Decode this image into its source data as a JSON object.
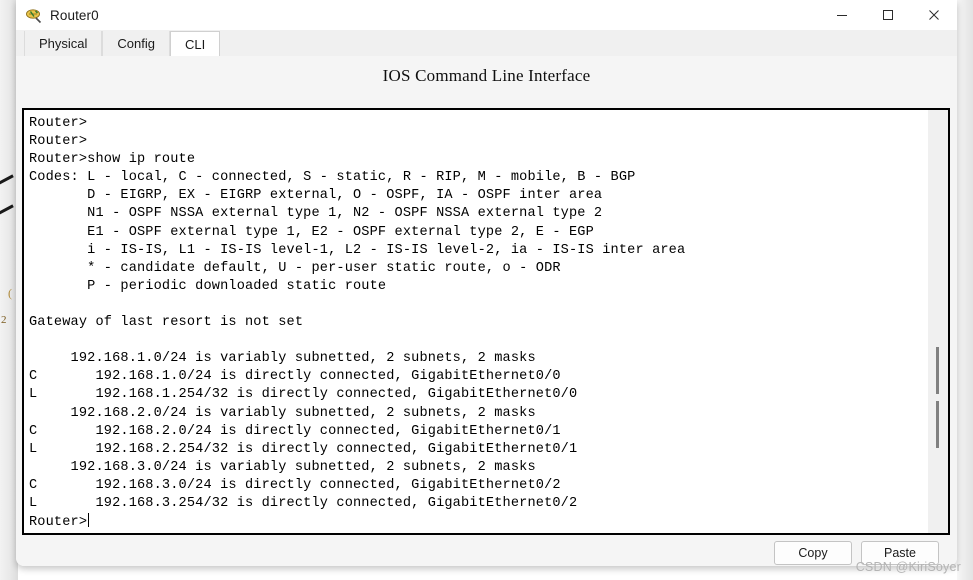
{
  "window": {
    "title": "Router0",
    "icon": "router-icon",
    "controls": [
      {
        "name": "minimize",
        "glyph": "minimize-icon"
      },
      {
        "name": "maximize",
        "glyph": "maximize-icon"
      },
      {
        "name": "close",
        "glyph": "close-icon"
      }
    ]
  },
  "tabs": [
    {
      "label": "Physical",
      "active": false
    },
    {
      "label": "Config",
      "active": false
    },
    {
      "label": "CLI",
      "active": true
    }
  ],
  "cli": {
    "heading": "IOS Command Line Interface",
    "lines": [
      "Router>",
      "Router>",
      "Router>show ip route",
      "Codes: L - local, C - connected, S - static, R - RIP, M - mobile, B - BGP",
      "       D - EIGRP, EX - EIGRP external, O - OSPF, IA - OSPF inter area",
      "       N1 - OSPF NSSA external type 1, N2 - OSPF NSSA external type 2",
      "       E1 - OSPF external type 1, E2 - OSPF external type 2, E - EGP",
      "       i - IS-IS, L1 - IS-IS level-1, L2 - IS-IS level-2, ia - IS-IS inter area",
      "       * - candidate default, U - per-user static route, o - ODR",
      "       P - periodic downloaded static route",
      "",
      "Gateway of last resort is not set",
      "",
      "     192.168.1.0/24 is variably subnetted, 2 subnets, 2 masks",
      "C       192.168.1.0/24 is directly connected, GigabitEthernet0/0",
      "L       192.168.1.254/32 is directly connected, GigabitEthernet0/0",
      "     192.168.2.0/24 is variably subnetted, 2 subnets, 2 masks",
      "C       192.168.2.0/24 is directly connected, GigabitEthernet0/1",
      "L       192.168.2.254/32 is directly connected, GigabitEthernet0/1",
      "     192.168.3.0/24 is variably subnetted, 2 subnets, 2 masks",
      "C       192.168.3.0/24 is directly connected, GigabitEthernet0/2",
      "L       192.168.3.254/32 is directly connected, GigabitEthernet0/2"
    ],
    "prompt": "Router>"
  },
  "footer": {
    "copy_label": "Copy",
    "paste_label": "Paste"
  },
  "watermark": "CSDN @KiriSoyer",
  "background": {
    "number_fragment": "2",
    "paren_fragment": "("
  },
  "colors": {
    "terminal_text": "#000000",
    "terminal_bg": "#ffffff",
    "window_bg": "#f5f5f5",
    "tab_active_bg": "#ffffff",
    "watermark": "#b4b4b4"
  }
}
